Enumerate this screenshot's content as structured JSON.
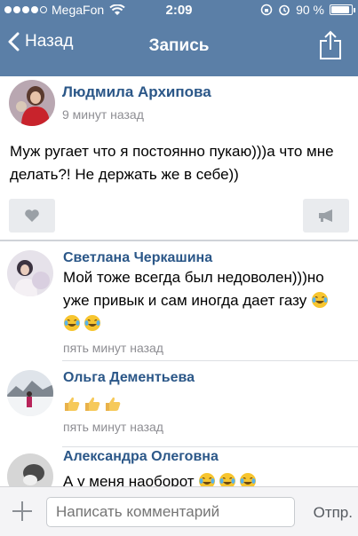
{
  "status_bar": {
    "carrier": "MegaFon",
    "time": "2:09",
    "battery": "90 %",
    "battery_level": 0.9
  },
  "nav": {
    "back_label": "Назад",
    "title": "Запись"
  },
  "post": {
    "author": "Людмила Архипова",
    "time": "9 минут назад",
    "text": "Муж ругает что я постоянно пукаю)))а что мне делать?! Не держать же в себе))"
  },
  "comments": [
    {
      "author": "Светлана Черкашина",
      "text": "Мой тоже всегда был недоволен)))но уже привык  и сам иногда дает газу",
      "time": "пять минут назад"
    },
    {
      "author": "Ольга Дементьева",
      "text": "",
      "time": "пять минут назад"
    },
    {
      "author": "Александра Олеговна",
      "text": "А у меня наоборот"
    }
  ],
  "composer": {
    "placeholder": "Написать комментарий",
    "send_label": "Отпр."
  },
  "colors": {
    "nav_bar": "#5b7fa7",
    "link_blue": "#2b5788",
    "meta_gray": "#8e8e93"
  },
  "icons": {
    "back": "chevron-left-icon",
    "share": "share-icon",
    "like": "heart-icon",
    "repost": "megaphone-icon",
    "attach": "plus-icon",
    "laugh": "laughing-tears-emoji",
    "thumbs": "thumbs-up-emoji"
  }
}
